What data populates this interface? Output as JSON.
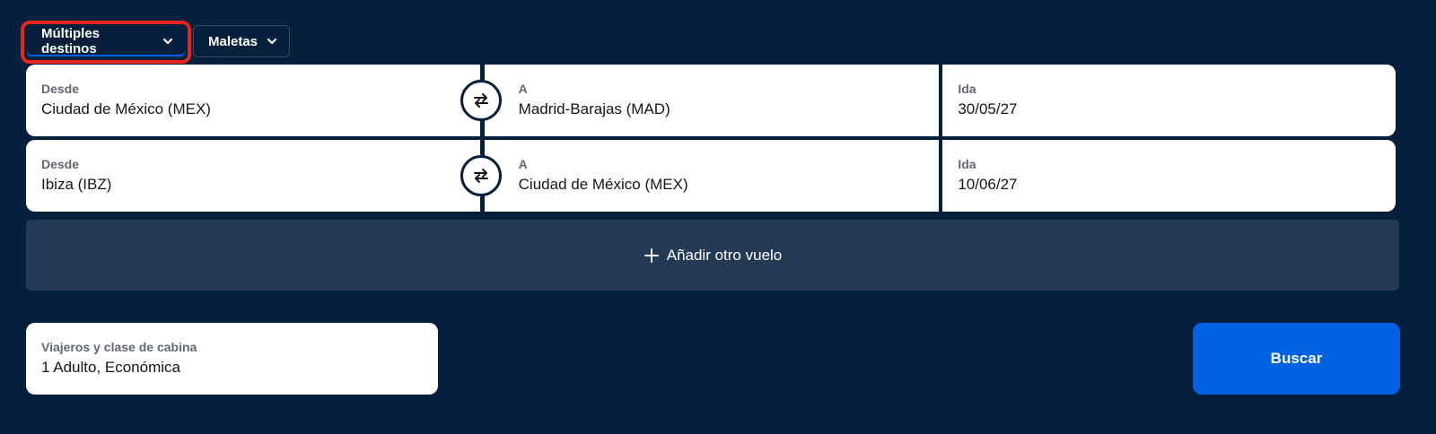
{
  "trip_type": {
    "label": "Múltiples destinos",
    "highlighted": true
  },
  "bags": {
    "label": "Maletas"
  },
  "legs": [
    {
      "from_label": "Desde",
      "from_value": "Ciudad de México (MEX)",
      "to_label": "A",
      "to_value": "Madrid-Barajas (MAD)",
      "date_label": "Ida",
      "date_value": "30/05/27"
    },
    {
      "from_label": "Desde",
      "from_value": "Ibiza (IBZ)",
      "to_label": "A",
      "to_value": "Ciudad de México (MEX)",
      "date_label": "Ida",
      "date_value": "10/06/27"
    }
  ],
  "add_flight": {
    "label": "Añadir otro vuelo"
  },
  "travellers": {
    "label": "Viajeros y clase de cabina",
    "value": "1 Adulto, Económica"
  },
  "search": {
    "label": "Buscar"
  },
  "icons": {
    "trip_type_chevron": "chevron-down-icon",
    "bags_chevron": "chevron-down-icon",
    "swap": "swap-arrows-icon",
    "add": "plus-icon"
  },
  "colors": {
    "background": "#05203c",
    "field": "#ffffff",
    "add_flight_bg": "#243954",
    "primary": "#0062e3",
    "highlight": "#e8241b",
    "label_text": "#626971",
    "value_text": "#161616"
  }
}
